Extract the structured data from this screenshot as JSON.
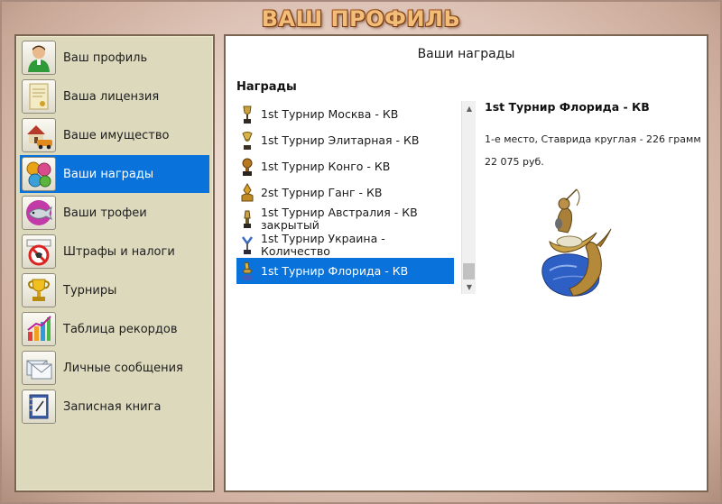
{
  "header": {
    "title": "ВАШ ПРОФИЛЬ"
  },
  "sidebar": {
    "items": [
      {
        "label": "Ваш профиль",
        "icon": "person-icon"
      },
      {
        "label": "Ваша лицензия",
        "icon": "certificate-icon"
      },
      {
        "label": "Ваше имущество",
        "icon": "house-car-icon"
      },
      {
        "label": "Ваши награды",
        "icon": "medals-icon",
        "active": true
      },
      {
        "label": "Ваши трофеи",
        "icon": "fish-trophy-icon"
      },
      {
        "label": "Штрафы и налоги",
        "icon": "fines-sign-icon"
      },
      {
        "label": "Турниры",
        "icon": "cup-icon"
      },
      {
        "label": "Таблица рекордов",
        "icon": "records-chart-icon"
      },
      {
        "label": "Личные сообщения",
        "icon": "messages-icon"
      },
      {
        "label": "Записная книга",
        "icon": "notebook-icon"
      }
    ]
  },
  "main": {
    "title": "Ваши награды",
    "awards_label": "Награды",
    "awards": [
      {
        "name": "1st Турнир Москва - КВ"
      },
      {
        "name": "1st Турнир Элитарная - КВ"
      },
      {
        "name": "1st Турнир Конго - КВ"
      },
      {
        "name": "2st Турнир Ганг - КВ"
      },
      {
        "name": "1st Турнир Австралия - КВ закрытый"
      },
      {
        "name": "1st Турнир Украина - Количество"
      },
      {
        "name": "1st Турнир Флорида - КВ",
        "selected": true
      }
    ],
    "detail": {
      "title": "1st Турнир Флорида - КВ",
      "place": "1-е место, Ставрида круглая - 226 грамм",
      "price": "22 075 руб."
    }
  },
  "colors": {
    "accent": "#0a73db",
    "sidebar_bg": "#ddd9bd",
    "title_text": "#f2bd78"
  }
}
